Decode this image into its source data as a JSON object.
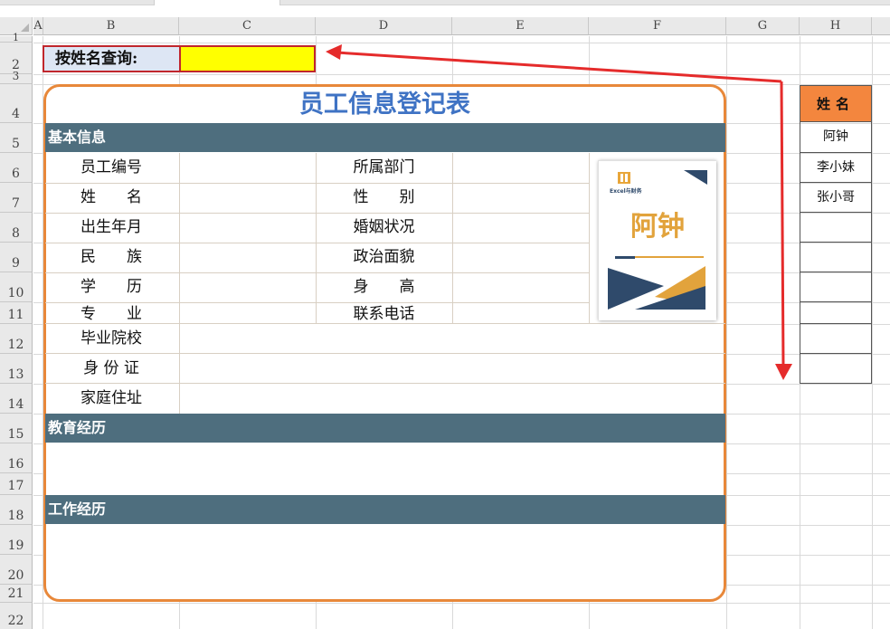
{
  "columns": [
    "A",
    "B",
    "C",
    "D",
    "E",
    "F",
    "G",
    "H"
  ],
  "rows": [
    "1",
    "2",
    "3",
    "4",
    "5",
    "6",
    "7",
    "8",
    "9",
    "10",
    "11",
    "12",
    "13",
    "14",
    "15",
    "16",
    "17",
    "18",
    "19",
    "20",
    "21",
    "22"
  ],
  "query": {
    "label": "按姓名查询:",
    "value": ""
  },
  "form": {
    "title": "员工信息登记表",
    "sections": {
      "basic": "基本信息",
      "education": "教育经历",
      "work": "工作经历"
    },
    "labels": {
      "emp_id": "员工编号",
      "name": "姓　　名",
      "birth": "出生年月",
      "ethnicity": "民　　族",
      "education": "学　　历",
      "major": "专　　业",
      "school": "毕业院校",
      "id_card": "身 份 证",
      "address": "家庭住址",
      "dept": "所属部门",
      "gender": "性　　别",
      "marital": "婚姻状况",
      "political": "政治面貌",
      "height": "身　　高",
      "phone": "联系电话"
    },
    "photo": {
      "brand": "Excel与财务",
      "name": "阿钟"
    }
  },
  "names": {
    "header": "姓名",
    "list": [
      "阿钟",
      "李小妹",
      "张小哥",
      "",
      "",
      "",
      "",
      "",
      ""
    ]
  },
  "colors": {
    "accent_orange": "#e8883a",
    "section_bar": "#4e6e7e",
    "title_blue": "#3f73c4",
    "arrow_red": "#e52b2b",
    "highlight_yellow": "#ffff00"
  }
}
